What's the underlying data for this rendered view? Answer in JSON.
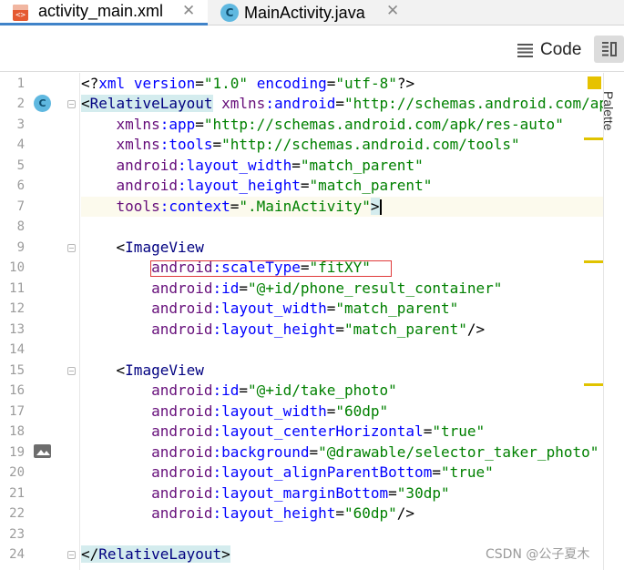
{
  "tabs": [
    {
      "label": "activity_main.xml",
      "icon": "xml-file-icon",
      "active": true,
      "close": "✕"
    },
    {
      "label": "MainActivity.java",
      "icon": "java-class-icon",
      "active": false,
      "close": "✕"
    }
  ],
  "class_icon_letter": "C",
  "toolbar": {
    "code_label": "Code",
    "code_icon": "lines-icon",
    "split_icon": "split-view-icon"
  },
  "right_panel": {
    "palette_label": "Palette"
  },
  "colors": {
    "tag": "#000080",
    "attribute_namespace": "#660e7a",
    "attribute": "#0000ff",
    "value": "#008000",
    "highlight_box": "#e03a3a",
    "marker": "#e0c300"
  },
  "line_numbers": [
    "1",
    "2",
    "3",
    "4",
    "5",
    "6",
    "7",
    "8",
    "9",
    "10",
    "11",
    "12",
    "13",
    "14",
    "15",
    "16",
    "17",
    "18",
    "19",
    "20",
    "21",
    "22",
    "23",
    "24"
  ],
  "code_lines": [
    "<?xml version=\"1.0\" encoding=\"utf-8\"?>",
    "<RelativeLayout xmlns:android=\"http://schemas.android.com/apk/res/android\"",
    "    xmlns:app=\"http://schemas.android.com/apk/res-auto\"",
    "    xmlns:tools=\"http://schemas.android.com/tools\"",
    "    android:layout_width=\"match_parent\"",
    "    android:layout_height=\"match_parent\"",
    "    tools:context=\".MainActivity\">",
    "",
    "    <ImageView",
    "        android:scaleType=\"fitXY\"",
    "        android:id=\"@+id/phone_result_container\"",
    "        android:layout_width=\"match_parent\"",
    "        android:layout_height=\"match_parent\"/>",
    "",
    "    <ImageView",
    "        android:id=\"@+id/take_photo\"",
    "        android:layout_width=\"60dp\"",
    "        android:layout_centerHorizontal=\"true\"",
    "        android:background=\"@drawable/selector_taker_photo\"",
    "        android:layout_alignParentBottom=\"true\"",
    "        android:layout_marginBottom=\"30dp\"",
    "        android:layout_height=\"60dp\"/>",
    "",
    "</RelativeLayout>"
  ],
  "watermark": "CSDN @公子夏木"
}
